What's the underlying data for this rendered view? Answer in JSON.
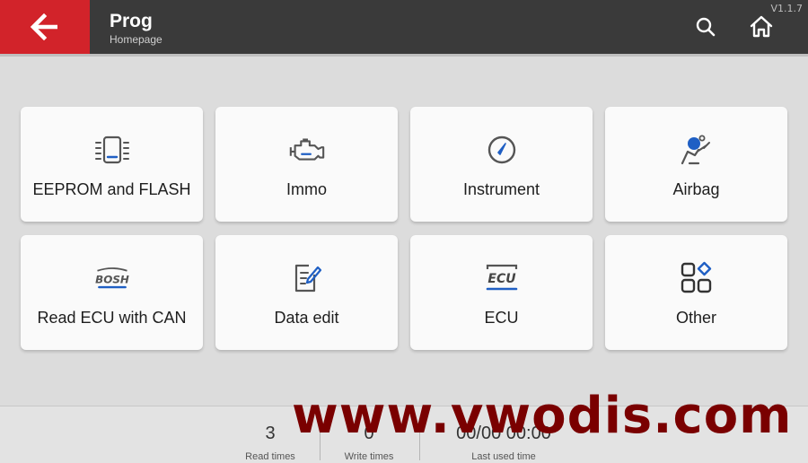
{
  "header": {
    "title": "Prog",
    "subtitle": "Homepage",
    "version": "V1.1.7",
    "back_icon": "arrow-left-icon",
    "search_icon": "search-icon",
    "home_icon": "home-icon"
  },
  "colors": {
    "accent": "#d2232a",
    "topbar": "#3a3a3a",
    "icon_blue": "#1f5fc4",
    "icon_gray": "#555555"
  },
  "modules": [
    {
      "label": "EEPROM and FLASH",
      "icon": "chip-memory-icon"
    },
    {
      "label": "Immo",
      "icon": "engine-icon"
    },
    {
      "label": "Instrument",
      "icon": "gauge-icon"
    },
    {
      "label": "Airbag",
      "icon": "airbag-icon"
    },
    {
      "label": "Read ECU with CAN",
      "icon": "bosh-logo-icon",
      "icon_text": "BOSH"
    },
    {
      "label": "Data edit",
      "icon": "edit-document-icon"
    },
    {
      "label": "ECU",
      "icon": "ecu-icon",
      "icon_text": "ECU"
    },
    {
      "label": "Other",
      "icon": "apps-grid-icon"
    }
  ],
  "footer": {
    "read_times": {
      "value": "3",
      "label": "Read times"
    },
    "write_times": {
      "value": "0",
      "label": "Write times"
    },
    "last_used": {
      "value": "00/00 00:00",
      "label": "Last used time"
    }
  },
  "watermark": "www.vwodis.com"
}
